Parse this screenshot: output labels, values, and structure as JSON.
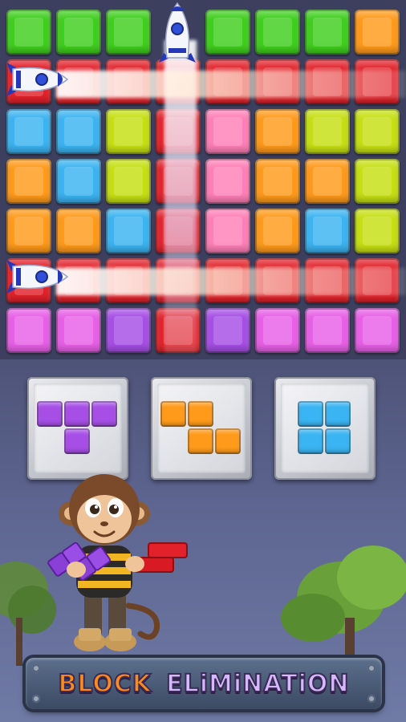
{
  "colors": {
    "green": "#3fcf1d",
    "orange": "#ff9a1a",
    "red": "#e3212a",
    "blue": "#3ab4f2",
    "yellow": "#c6e012",
    "pink": "#ff7fb8",
    "magenta": "#e85fe8",
    "purple": "#a64ee6",
    "board_bg": "#3c3f5e",
    "title_orange": "#ff8a1c",
    "title_lavender": "#d7b8ff"
  },
  "board": {
    "rows": [
      [
        "green",
        "green",
        "green",
        "empty",
        "green",
        "green",
        "green",
        "orange"
      ],
      [
        "red",
        "red",
        "red",
        "red",
        "red",
        "red",
        "red",
        "red"
      ],
      [
        "blue",
        "blue",
        "yellow",
        "red",
        "pink",
        "orange",
        "yellow",
        "yellow"
      ],
      [
        "orange",
        "blue",
        "yellow",
        "red",
        "pink",
        "orange",
        "orange",
        "yellow"
      ],
      [
        "orange",
        "orange",
        "blue",
        "red",
        "pink",
        "orange",
        "blue",
        "yellow"
      ],
      [
        "red",
        "red",
        "red",
        "red",
        "red",
        "red",
        "red",
        "red"
      ],
      [
        "magenta",
        "magenta",
        "purple",
        "red",
        "purple",
        "magenta",
        "magenta",
        "magenta"
      ]
    ]
  },
  "rockets": [
    {
      "name": "rocket-column-4",
      "icon": "rocket-icon"
    },
    {
      "name": "rocket-row-2",
      "icon": "rocket-icon"
    },
    {
      "name": "rocket-row-6",
      "icon": "rocket-icon"
    }
  ],
  "pieces": [
    {
      "name": "piece-t-purple",
      "color": "purple",
      "cells": [
        [
          0,
          0
        ],
        [
          1,
          0
        ],
        [
          2,
          0
        ],
        [
          1,
          1
        ]
      ]
    },
    {
      "name": "piece-z-orange",
      "color": "orange",
      "cells": [
        [
          0,
          0
        ],
        [
          1,
          0
        ],
        [
          1,
          1
        ],
        [
          2,
          1
        ]
      ]
    },
    {
      "name": "piece-square-blue",
      "color": "blue",
      "cells": [
        [
          0,
          0
        ],
        [
          1,
          0
        ],
        [
          0,
          1
        ],
        [
          1,
          1
        ]
      ]
    }
  ],
  "mascot": {
    "icon": "monkey-mascot-icon"
  },
  "title": {
    "word1": "BLOCK",
    "word2": "ELiMiNATiON"
  }
}
